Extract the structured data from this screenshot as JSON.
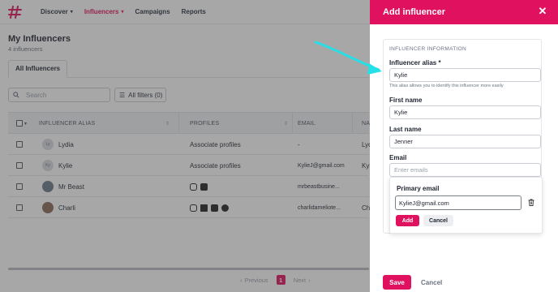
{
  "colors": {
    "brand": "#e0115f",
    "arrow": "#25e0e6"
  },
  "nav": {
    "items": [
      {
        "label": "Discover",
        "has_chevron": true
      },
      {
        "label": "Influencers",
        "has_chevron": true,
        "active": true
      },
      {
        "label": "Campaigns"
      },
      {
        "label": "Reports"
      }
    ]
  },
  "page": {
    "title": "My Influencers",
    "subtitle": "4 influencers",
    "tab": "All Influencers"
  },
  "toolbar": {
    "search_placeholder": "Search",
    "filters_label": "All filters (0)"
  },
  "table": {
    "columns": [
      "INFLUENCER ALIAS",
      "PROFILES",
      "EMAIL",
      "NA"
    ],
    "rows": [
      {
        "alias": "Lydia",
        "profiles_text": "Associate profiles",
        "email": "-",
        "name": "Lyd"
      },
      {
        "alias": "Kylie",
        "profiles_text": "Associate profiles",
        "email": "KylieJ@gmail.com",
        "name": "Kyl"
      },
      {
        "alias": "Mr Beast",
        "profiles_icons": [
          "instagram-icon",
          "youtube-icon"
        ],
        "email": "mrbeastbusine...",
        "name": ""
      },
      {
        "alias": "Charli",
        "profiles_icons": [
          "instagram-icon",
          "tiktok-icon",
          "youtube-icon",
          "facebook-icon"
        ],
        "email": "charlidameliote...",
        "name": "Cha"
      }
    ]
  },
  "pagination": {
    "prev": "Previous",
    "current": "1",
    "next": "Next"
  },
  "drawer": {
    "title": "Add influencer",
    "section": "INFLUENCER INFORMATION",
    "alias_label": "Influencer alias *",
    "alias_value": "Kylie",
    "alias_helper": "This alias allows you to identify this influencer more easily",
    "first_name_label": "First name",
    "first_name_value": "Kylie",
    "last_name_label": "Last name",
    "last_name_value": "Jenner",
    "email_label": "Email",
    "email_placeholder": "Enter emails",
    "primary_email_label": "Primary email",
    "primary_email_value": "KylieJ@gmail.com",
    "add_label": "Add",
    "cancel_small_label": "Cancel",
    "save_label": "Save",
    "cancel_label": "Cancel"
  }
}
